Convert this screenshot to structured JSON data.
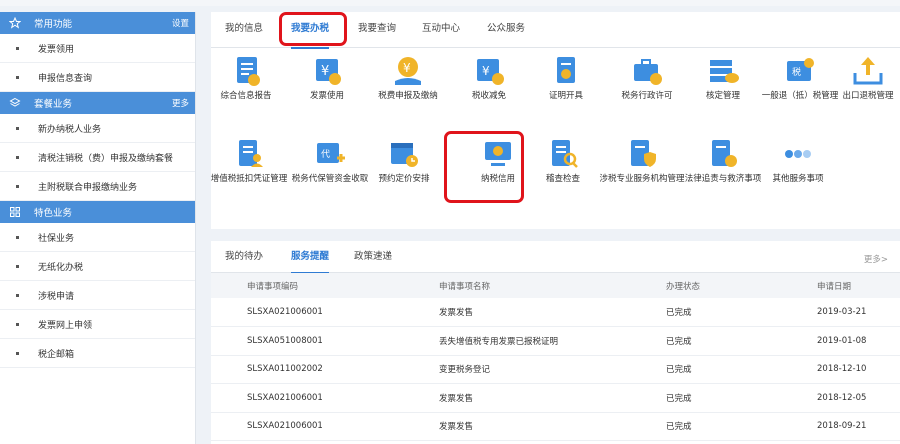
{
  "colors": {
    "primary": "#4a8fd9",
    "active_tab": "#2f7bd3",
    "highlight_red": "#e0141b"
  },
  "sidebar": {
    "sections": [
      {
        "icon": "star-icon",
        "title": "常用功能",
        "link": "设置",
        "items": [
          "发票领用",
          "申报信息查询"
        ]
      },
      {
        "icon": "layers-icon",
        "title": "套餐业务",
        "link": "更多",
        "items": [
          "新办纳税人业务",
          "清税注销税（费）申报及缴纳套餐",
          "主附税联合申报缴纳业务"
        ]
      },
      {
        "icon": "grid-icon",
        "title": "特色业务",
        "link": "",
        "items": [
          "社保业务",
          "无纸化办税",
          "涉税申请",
          "发票网上申领",
          "税企邮箱"
        ]
      }
    ]
  },
  "top_panel": {
    "tabs": [
      "我的信息",
      "我要办税",
      "我要查询",
      "互动中心",
      "公众服务"
    ],
    "active_tab": "我要办税",
    "services_row1": [
      {
        "label": "综合信息报告",
        "icon": "document-info-icon"
      },
      {
        "label": "发票使用",
        "icon": "invoice-yen-icon"
      },
      {
        "label": "税费申报及缴纳",
        "icon": "yen-hand-icon"
      },
      {
        "label": "税收减免",
        "icon": "tax-relief-icon"
      },
      {
        "label": "证明开具",
        "icon": "certificate-icon"
      },
      {
        "label": "税务行政许可",
        "icon": "briefcase-check-icon"
      },
      {
        "label": "核定管理",
        "icon": "stack-cloud-icon"
      },
      {
        "label": "一般退（抵）税管理",
        "icon": "refund-icon"
      },
      {
        "label": "出口退税管理",
        "icon": "export-tray-icon"
      }
    ],
    "services_row2": [
      {
        "label": "增值税抵扣凭证管理",
        "icon": "receipt-person-icon"
      },
      {
        "label": "税务代保管资金收取",
        "icon": "agent-plus-icon"
      },
      {
        "label": "预约定价安排",
        "icon": "calendar-clock-icon"
      },
      {
        "label": "纳税信用",
        "icon": "credit-monitor-icon"
      },
      {
        "label": "稽查检查",
        "icon": "inspect-search-icon"
      },
      {
        "label": "涉税专业服务机构管理",
        "icon": "agency-shield-icon"
      },
      {
        "label": "法律追责与救济事项",
        "icon": "law-scale-icon"
      },
      {
        "label": "其他服务事项",
        "icon": "more-dots-icon"
      }
    ]
  },
  "bottom_panel": {
    "tabs": [
      "我的待办",
      "服务提醒",
      "政策速递"
    ],
    "active_tab": "服务提醒",
    "more": "更多>",
    "columns": [
      "申请事项编码",
      "申请事项名称",
      "办理状态",
      "申请日期"
    ],
    "rows": [
      [
        "SLSXA021006001",
        "发票发售",
        "已完成",
        "2019-03-21"
      ],
      [
        "SLSXA051008001",
        "丢失增值税专用发票已报税证明",
        "已完成",
        "2019-01-08"
      ],
      [
        "SLSXA011002002",
        "变更税务登记",
        "已完成",
        "2018-12-10"
      ],
      [
        "SLSXA021006001",
        "发票发售",
        "已完成",
        "2018-12-05"
      ],
      [
        "SLSXA021006001",
        "发票发售",
        "已完成",
        "2018-09-21"
      ]
    ]
  }
}
